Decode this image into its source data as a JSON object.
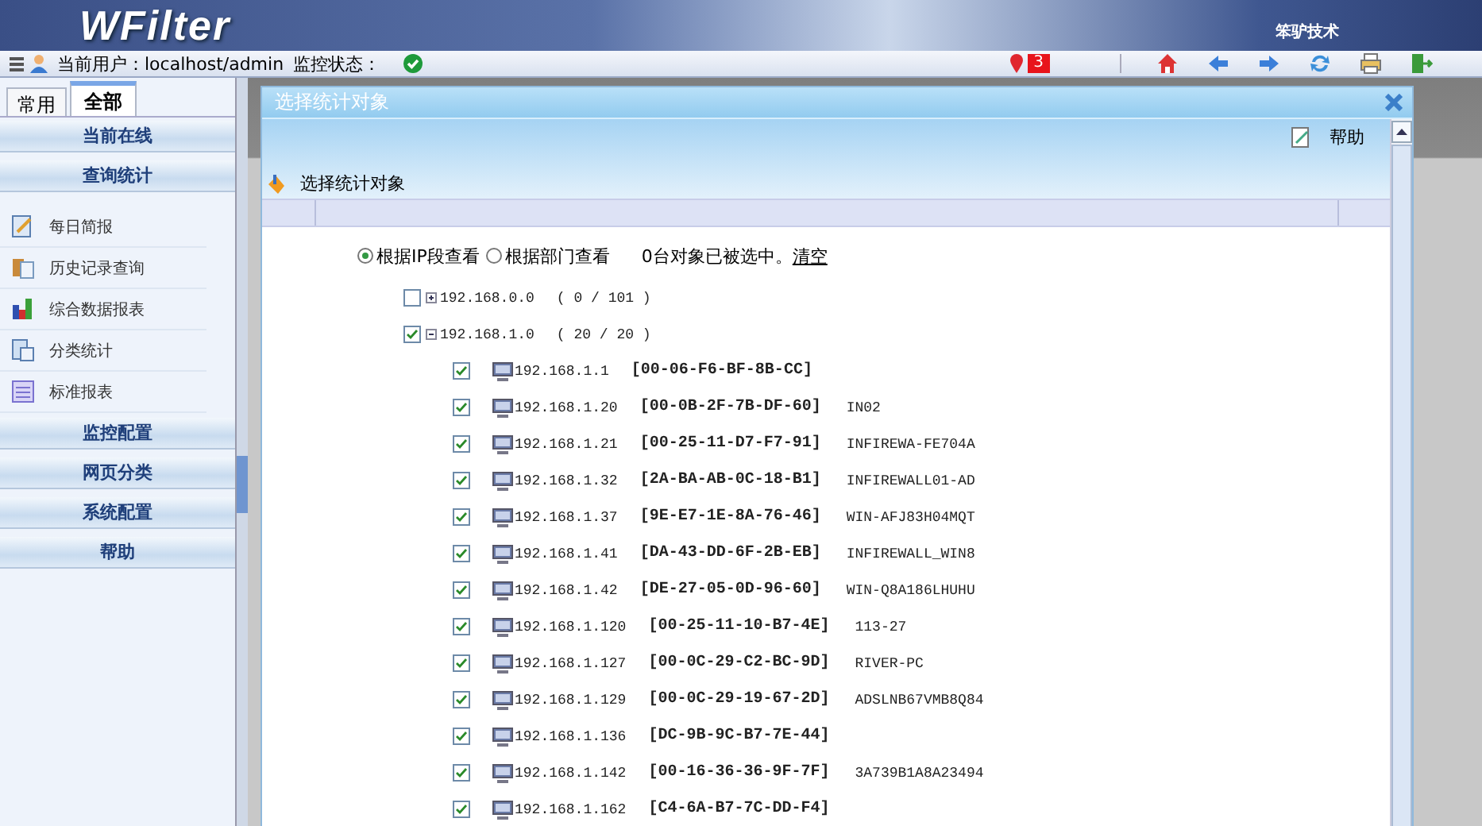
{
  "header": {
    "logo": "WFilter",
    "company": "笨驴技术"
  },
  "toolbar": {
    "user_label": "当前用户：",
    "user": "localhost/admin",
    "monitor_label": "监控状态：",
    "alert_count": "3"
  },
  "sidebar": {
    "tabs": [
      {
        "label": "常用",
        "selected": false
      },
      {
        "label": "全部",
        "selected": true
      }
    ],
    "sections": [
      {
        "label": "当前在线"
      },
      {
        "label": "查询统计",
        "items": [
          {
            "label": "每日简报",
            "kind": "report"
          },
          {
            "label": "历史记录查询",
            "kind": "history"
          },
          {
            "label": "综合数据报表",
            "kind": "chart"
          },
          {
            "label": "分类统计",
            "kind": "category"
          },
          {
            "label": "标准报表",
            "kind": "list"
          }
        ]
      },
      {
        "label": "监控配置"
      },
      {
        "label": "网页分类"
      },
      {
        "label": "系统配置"
      },
      {
        "label": "帮助"
      }
    ]
  },
  "dialog": {
    "title": "选择统计对象",
    "help": "帮助",
    "subtitle": "选择统计对象",
    "view_options": [
      {
        "label": "根据IP段查看",
        "selected": true
      },
      {
        "label": "根据部门查看",
        "selected": false
      }
    ],
    "selection_text": "0台对象已被选中。",
    "clear_link": "清空",
    "groups": [
      {
        "label": "192.168.0.0",
        "count": "( 0 / 101 )",
        "checked": false,
        "expanded": false
      },
      {
        "label": "192.168.1.0",
        "count": "( 20 / 20 )",
        "checked": true,
        "expanded": true,
        "hosts": [
          {
            "ip": "192.168.1.1",
            "mac": "[00-06-F6-BF-8B-CC]",
            "checked": true
          },
          {
            "ip": "192.168.1.20",
            "mac": "[00-0B-2F-7B-DF-60]",
            "name": "IN02",
            "checked": true
          },
          {
            "ip": "192.168.1.21",
            "mac": "[00-25-11-D7-F7-91]",
            "name": "INFIREWA-FE704A",
            "checked": true
          },
          {
            "ip": "192.168.1.32",
            "mac": "[2A-BA-AB-0C-18-B1]",
            "name": "INFIREWALL01-AD",
            "checked": true
          },
          {
            "ip": "192.168.1.37",
            "mac": "[9E-E7-1E-8A-76-46]",
            "name": "WIN-AFJ83H04MQT",
            "checked": true
          },
          {
            "ip": "192.168.1.41",
            "mac": "[DA-43-DD-6F-2B-EB]",
            "name": "INFIREWALL_WIN8",
            "checked": true
          },
          {
            "ip": "192.168.1.42",
            "mac": "[DE-27-05-0D-96-60]",
            "name": "WIN-Q8A186LHUHU",
            "checked": true
          },
          {
            "ip": "192.168.1.120",
            "mac": "[00-25-11-10-B7-4E]",
            "name": "113-27",
            "checked": true
          },
          {
            "ip": "192.168.1.127",
            "mac": "[00-0C-29-C2-BC-9D]",
            "name": "RIVER-PC",
            "checked": true
          },
          {
            "ip": "192.168.1.129",
            "mac": "[00-0C-29-19-67-2D]",
            "name": "ADSLNB67VMB8Q84",
            "checked": true
          },
          {
            "ip": "192.168.1.136",
            "mac": "[DC-9B-9C-B7-7E-44]",
            "checked": true
          },
          {
            "ip": "192.168.1.142",
            "mac": "[00-16-36-36-9F-7F]",
            "name": "3A739B1A8A23494",
            "checked": true
          },
          {
            "ip": "192.168.1.162",
            "mac": "[C4-6A-B7-7C-DD-F4]",
            "checked": true
          }
        ]
      }
    ]
  }
}
